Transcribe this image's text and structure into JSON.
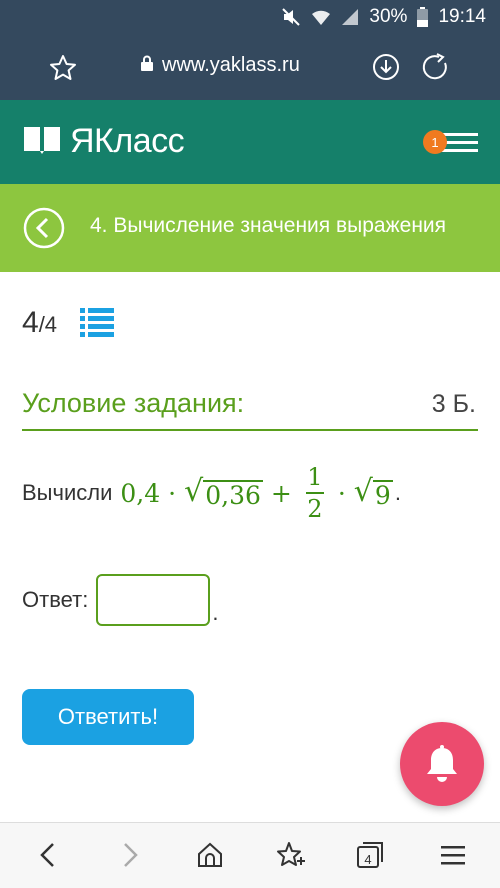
{
  "status_bar": {
    "battery": "30%",
    "time": "19:14"
  },
  "browser": {
    "url": "www.yaklass.ru"
  },
  "header": {
    "logo_text": "ЯКласс",
    "notification_count": "1"
  },
  "topic": {
    "title": "4. Вычисление значения выражения"
  },
  "task": {
    "current": "4",
    "total": "/4",
    "condition_label": "Условие задания:",
    "score": "3 Б.",
    "prompt": "Вычисли",
    "expression": {
      "a": "0,4",
      "dot": "·",
      "radicand1": "0,36",
      "plus": "+",
      "frac_num": "1",
      "frac_den": "2",
      "radicand2": "9",
      "end": "."
    },
    "answer_label": "Ответ:",
    "answer_value": "",
    "answer_end": ".",
    "submit_label": "Ответить!"
  },
  "bottom_nav": {
    "tabs_count": "4"
  },
  "colors": {
    "status_bar": "#34495e",
    "header": "#15806a",
    "topic_bar": "#8dc63f",
    "accent_green": "#5a9f1d",
    "math_green": "#3c8f14",
    "button_blue": "#1ba1e2",
    "bell_pink": "#ec4b6e",
    "badge_orange": "#f07a1f"
  },
  "icons": [
    "mute-icon",
    "wifi-icon",
    "signal-icon",
    "battery-icon",
    "star-icon",
    "lock-icon",
    "download-icon",
    "refresh-icon",
    "book-logo-icon",
    "menu-icon",
    "back-chevron-icon",
    "list-icon",
    "bell-icon",
    "back-arrow-icon",
    "forward-arrow-icon",
    "home-icon",
    "bookmark-star-icon",
    "tabs-icon",
    "overflow-menu-icon"
  ]
}
